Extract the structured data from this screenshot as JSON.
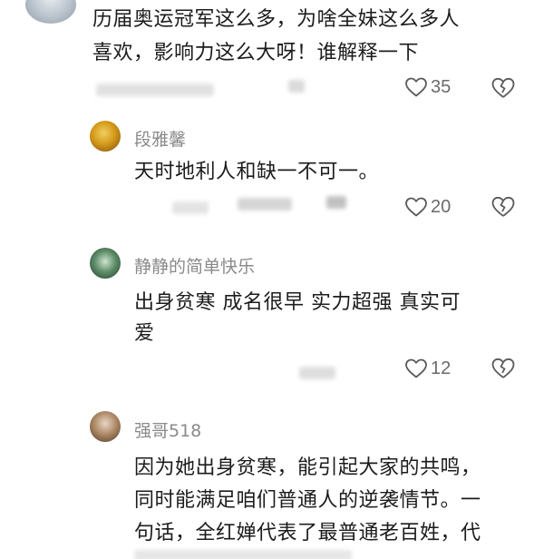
{
  "comments": [
    {
      "username": "",
      "text": "历届奥运冠军这么多，为啥全妹这么多人\n喜欢，影响力这么大呀！谁解释一下",
      "likes": "35"
    },
    {
      "username": "段雅馨",
      "text": "天时地利人和缺一不可一。",
      "likes": "20"
    },
    {
      "username": "静静的简单快乐",
      "text": "出身贫寒  成名很早  实力超强  真实可\n爱",
      "likes": "12"
    },
    {
      "username": "强哥518",
      "text": "因为她出身贫寒，能引起大家的共鸣，\n同时能满足咱们普通人的逆袭情节。一\n句话，全红婵代表了最普通老百姓，代",
      "likes": ""
    }
  ],
  "icons": {
    "like": "heart-outline-icon",
    "dislike": "broken-heart-icon"
  }
}
